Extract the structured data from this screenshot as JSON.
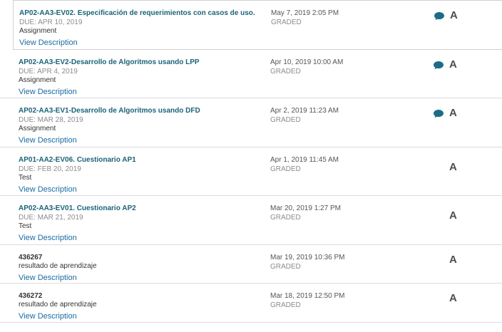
{
  "assignments": [
    {
      "title": "AP02-AA3-EV02. Especificación de requerimientos con casos de uso.",
      "due": "DUE: APR 10, 2019",
      "type": "Assignment",
      "link": "View Description",
      "date": "May 7, 2019 2:05 PM",
      "status": "GRADED",
      "grade": "A",
      "has_comment": true
    },
    {
      "title": "AP02-AA3-EV2-Desarrollo de Algoritmos usando LPP",
      "due": "DUE: APR 4, 2019",
      "type": "Assignment",
      "link": "View Description",
      "date": "Apr 10, 2019 10:00 AM",
      "status": "GRADED",
      "grade": "A",
      "has_comment": true
    },
    {
      "title": "AP02-AA3-EV1-Desarrollo de Algoritmos usando DFD",
      "due": "DUE: MAR 28, 2019",
      "type": "Assignment",
      "link": "View Description",
      "date": "Apr 2, 2019 11:23 AM",
      "status": "GRADED",
      "grade": "A",
      "has_comment": true
    },
    {
      "title": "AP01-AA2-EV06. Cuestionario AP1",
      "due": "DUE: FEB 20, 2019",
      "type": "Test",
      "link": "View Description",
      "date": "Apr 1, 2019 11:45 AM",
      "status": "GRADED",
      "grade": "A",
      "has_comment": false
    },
    {
      "title": "AP02-AA3-EV01. Cuestionario AP2",
      "due": "DUE: MAR 21, 2019",
      "type": "Test",
      "link": "View Description",
      "date": "Mar 20, 2019 1:27 PM",
      "status": "GRADED",
      "grade": "A",
      "has_comment": false
    },
    {
      "title": "436267",
      "subtitle": "resultado de aprendizaje",
      "link": "View Description",
      "date": "Mar 19, 2019 10:36 PM",
      "status": "GRADED",
      "grade": "A",
      "has_comment": false
    },
    {
      "title": "436272",
      "subtitle": "resultado de aprendizaje",
      "link": "View Description",
      "date": "Mar 18, 2019 12:50 PM",
      "status": "GRADED",
      "grade": "A",
      "has_comment": false
    }
  ],
  "colors": {
    "title_link": "#1b6379",
    "link": "#1b6aa5",
    "comment_icon": "#1b6d85",
    "muted": "#8c8c8c"
  },
  "icons": {
    "comment": "speech-bubble-icon"
  }
}
